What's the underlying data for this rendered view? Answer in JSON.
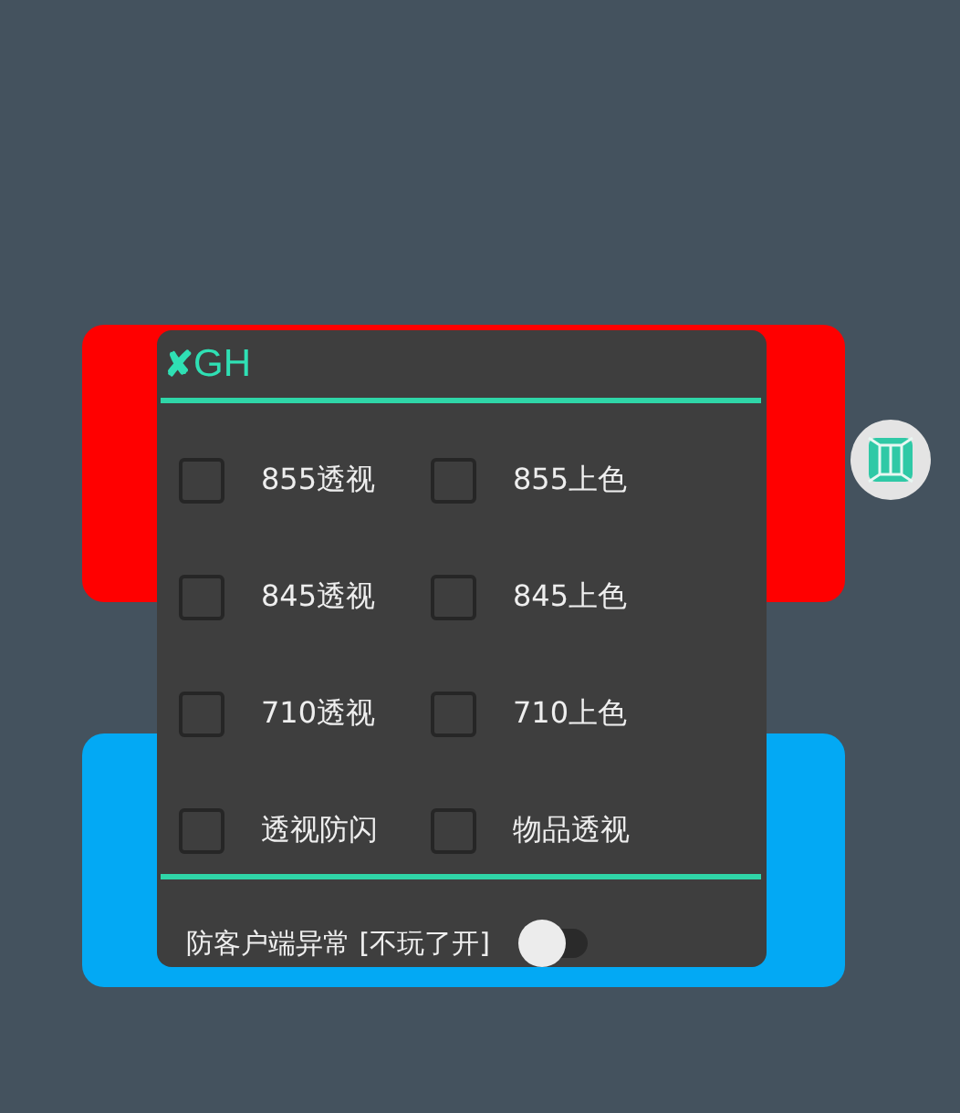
{
  "panel": {
    "title_mark": "✘",
    "title": "GH",
    "options": [
      {
        "label": "855透视",
        "checked": false
      },
      {
        "label": "855上色",
        "checked": false
      },
      {
        "label": "845透视",
        "checked": false
      },
      {
        "label": "845上色",
        "checked": false
      },
      {
        "label": "710透视",
        "checked": false
      },
      {
        "label": "710上色",
        "checked": false
      },
      {
        "label": "透视防闪",
        "checked": false
      },
      {
        "label": "物品透视",
        "checked": false
      }
    ],
    "toggle": {
      "label": "防客户端异常 [不玩了开]",
      "on": false
    }
  }
}
